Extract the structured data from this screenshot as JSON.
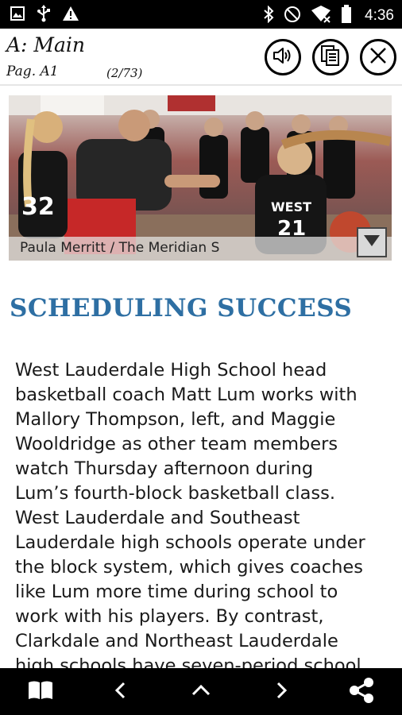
{
  "status_bar": {
    "time": "4:36",
    "left_icons": [
      "image-icon",
      "usb-icon",
      "warning-icon"
    ],
    "right_icons": [
      "bluetooth-icon",
      "do-not-disturb-icon",
      "wifi-icon",
      "battery-icon"
    ]
  },
  "header": {
    "section_title": "A: Main",
    "page_label": "Pag. A1",
    "page_count": "(2/73)",
    "buttons": [
      "speaker-icon",
      "pages-icon",
      "close-icon"
    ]
  },
  "photo": {
    "caption": "Paula Merritt / The Meridian S",
    "expand_icon": "triangle-down-icon",
    "jersey_numbers": [
      "32",
      "21"
    ],
    "jersey_text": "WEST"
  },
  "article": {
    "headline": "SCHEDULING SUCCESS",
    "body_lines": [
      "West Lauderdale High School head",
      "basketball coach Matt Lum works with",
      "Mallory Thompson, left, and Maggie",
      "Wooldridge as other team members",
      "watch Thursday afternoon during",
      "Lum’s fourth-block basketball class.",
      "West Lauderdale and Southeast",
      "Lauderdale high schools operate under",
      "the block system, which gives coaches",
      "like Lum more time during school to",
      "work with his players. By contrast,",
      "Clarkdale and Northeast Lauderdale",
      "high schools have seven-period school"
    ]
  },
  "nav_bar": {
    "items": [
      "book-icon",
      "chevron-left-icon",
      "chevron-up-icon",
      "chevron-right-icon",
      "share-icon"
    ]
  },
  "colors": {
    "headline": "#2e6fa3",
    "status_bar": "#000000",
    "nav_bar": "#000000"
  }
}
